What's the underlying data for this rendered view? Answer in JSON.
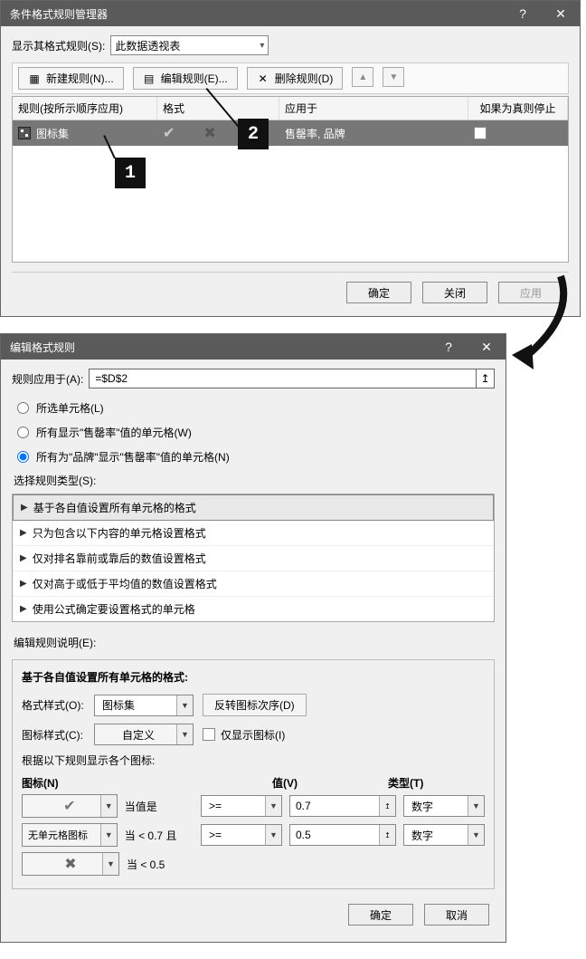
{
  "mgr": {
    "title": "条件格式规则管理器",
    "show_rules_label": "显示其格式规则(S):",
    "show_rules_value": "此数据透视表",
    "btn_new": "新建规则(N)...",
    "btn_edit": "编辑规则(E)...",
    "btn_delete": "删除规则(D)",
    "cols": {
      "rule": "规则(按所示顺序应用)",
      "format": "格式",
      "applied": "应用于",
      "stop": "如果为真则停止"
    },
    "row1": {
      "name": "图标集",
      "applied": "售罄率, 品牌"
    },
    "ok": "确定",
    "close": "关闭",
    "apply": "应用"
  },
  "callout1": "1",
  "callout2": "2",
  "edit": {
    "title": "编辑格式规则",
    "apply_to_label": "规则应用于(A):",
    "apply_to_value": "=$D$2",
    "radio1": "所选单元格(L)",
    "radio2": "所有显示\"售罄率\"值的单元格(W)",
    "radio3": "所有为\"品牌\"显示\"售罄率\"值的单元格(N)",
    "select_type_label": "选择规则类型(S):",
    "types": [
      "基于各自值设置所有单元格的格式",
      "只为包含以下内容的单元格设置格式",
      "仅对排名靠前或靠后的数值设置格式",
      "仅对高于或低于平均值的数值设置格式",
      "使用公式确定要设置格式的单元格"
    ],
    "desc_label": "编辑规则说明(E):",
    "inner_title": "基于各自值设置所有单元格的格式:",
    "format_style_label": "格式样式(O):",
    "format_style_value": "图标集",
    "reverse_btn": "反转图标次序(D)",
    "icon_style_label": "图标样式(C):",
    "icon_style_value": "自定义",
    "show_icon_only": "仅显示图标(I)",
    "rules_intro": "根据以下规则显示各个图标:",
    "h_icon": "图标(N)",
    "h_val": "值(V)",
    "h_type": "类型(T)",
    "rows": [
      {
        "icon": "check",
        "when": "当值是",
        "op": ">=",
        "val": "0.7",
        "type": "数字"
      },
      {
        "icon": "none",
        "icon_label": "无单元格图标",
        "when": "当 < 0.7 且",
        "op": ">=",
        "val": "0.5",
        "type": "数字"
      },
      {
        "icon": "x",
        "when": "当 < 0.5"
      }
    ],
    "ok": "确定",
    "cancel": "取消"
  }
}
